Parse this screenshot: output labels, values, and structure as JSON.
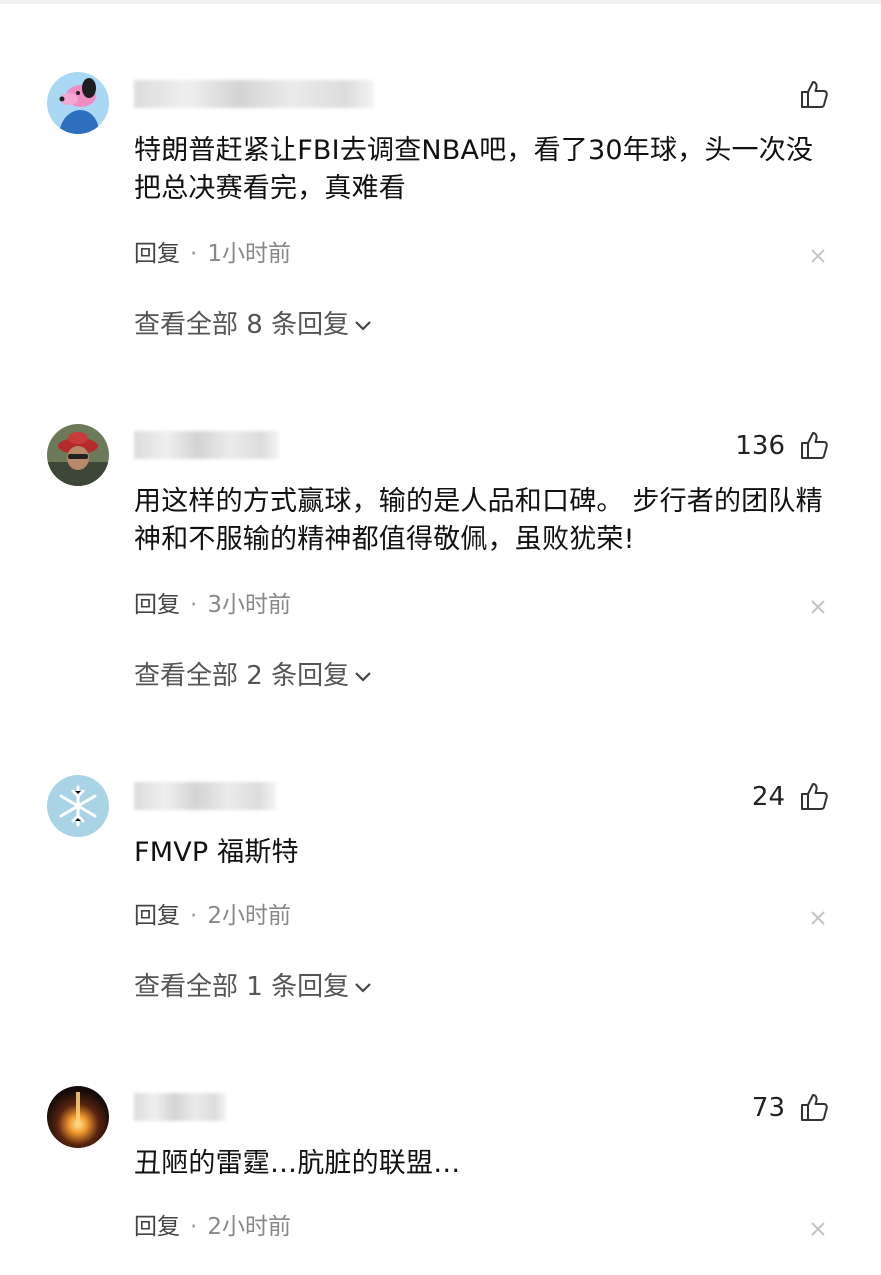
{
  "comments": [
    {
      "likes": "",
      "text": "特朗普赶紧让FBI去调查NBA吧，看了30年球，头一次没把总决赛看完，真难看",
      "reply_label": "回复",
      "separator": "·",
      "time": "1小时前",
      "view_replies": "查看全部 8 条回复"
    },
    {
      "likes": "136",
      "text": "用这样的方式赢球，输的是人品和口碑。 步行者的团队精神和不服输的精神都值得敬佩，虽败犹荣!",
      "reply_label": "回复",
      "separator": "·",
      "time": "3小时前",
      "view_replies": "查看全部 2 条回复"
    },
    {
      "likes": "24",
      "text": "FMVP 福斯特",
      "reply_label": "回复",
      "separator": "·",
      "time": "2小时前",
      "view_replies": "查看全部 1 条回复"
    },
    {
      "likes": "73",
      "text": "丑陋的雷霆…肮脏的联盟…",
      "reply_label": "回复",
      "separator": "·",
      "time": "2小时前"
    }
  ],
  "icons": {
    "like": "thumbs-up-icon",
    "close": "close-icon",
    "expand": "chevron-down-icon"
  },
  "colors": {
    "text": "#111111",
    "meta": "#888888",
    "link": "#555555",
    "icon": "#333333"
  }
}
